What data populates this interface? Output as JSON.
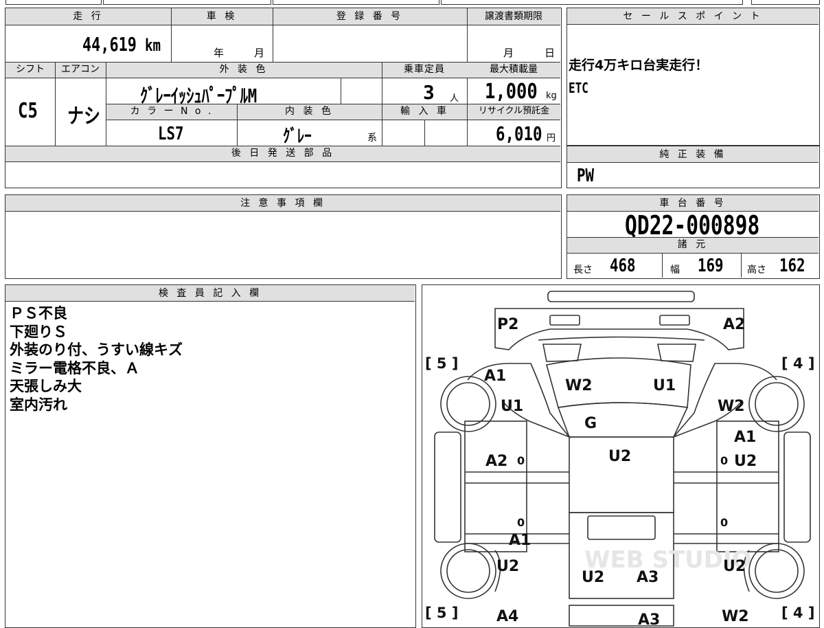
{
  "vehicle": {
    "mileage_label": "走 行",
    "mileage_value": "44,619",
    "mileage_unit": "km",
    "inspection_label": "車 検",
    "inspection_year_unit": "年",
    "inspection_month_unit": "月",
    "registration_label": "登 録 番 号",
    "transfer_deadline_label": "譲渡書類期限",
    "transfer_month_unit": "月",
    "transfer_day_unit": "日",
    "shift_label": "シフト",
    "shift_value": "C5",
    "aircon_label": "エアコン",
    "aircon_value": "ナシ",
    "exterior_color_label": "外 装 色",
    "exterior_color_value": "ｸﾞﾚｰｲｯｼｭﾊﾟｰﾌﾟﾙM",
    "capacity_label": "乗車定員",
    "capacity_value": "3",
    "capacity_unit": "人",
    "max_load_label": "最大積載量",
    "max_load_value": "1,000",
    "max_load_unit": "kg",
    "color_no_label": "カ ラ ー N o .",
    "color_no_value": "LS7",
    "interior_color_label": "内 装 色",
    "interior_color_value": "ｸﾞﾚｰ",
    "interior_color_suffix": "系",
    "import_label": "輸 入 車",
    "recycle_label": "リサイクル預託金",
    "recycle_value": "6,010",
    "recycle_unit": "円",
    "later_parts_label": "後 日 発 送 部 品"
  },
  "sales_point": {
    "label": "セ ー ル ス ポ イ ン ト",
    "lines": [
      "走行4万キロ台実走行！",
      "ETC"
    ]
  },
  "genuine_equipment": {
    "label": "純 正 装 備",
    "value": "PW"
  },
  "notes": {
    "label": "注 意 事 項 欄"
  },
  "chassis": {
    "label": "車 台 番 号",
    "value": "QD22-000898"
  },
  "specs": {
    "label": "諸 元",
    "length_label": "長さ",
    "length_value": "468",
    "width_label": "幅",
    "width_value": "169",
    "height_label": "高さ",
    "height_value": "162"
  },
  "inspector": {
    "label": "検 査 員 記 入 欄",
    "lines": [
      "ＰＳ不良",
      "下廻りＳ",
      "外装のり付、うすい線キズ",
      "ミラー電格不良、Ａ",
      "天張しみ大",
      "室内汚れ"
    ]
  },
  "diagram": {
    "marks": {
      "p2": "P2",
      "a2_top": "A2",
      "front_left_bracket": "[ 5 ]",
      "front_right_bracket": "[ 4 ]",
      "a1_left": "A1",
      "w2_windshield": "W2",
      "u1_windshield": "U1",
      "u1_left": "U1",
      "w2_right": "W2",
      "g_hood": "G",
      "a1_right": "A1",
      "a2_left": "A2",
      "u2_center": "U2",
      "u2_right": "U2",
      "a1_sill": "A1",
      "u2_left_rear": "U2",
      "u2_right_rear": "U2",
      "u2_bed": "U2",
      "a3_bed": "A3",
      "rear_left_bracket": "[ 5 ]",
      "rear_right_bracket": "[ 4 ]",
      "a4_left": "A4",
      "a3_bottom": "A3",
      "w2_bottom": "W2",
      "zero1": "0",
      "zero2": "0",
      "zero3": "0",
      "zero4": "0"
    },
    "watermark": "WEB STUDIO"
  }
}
